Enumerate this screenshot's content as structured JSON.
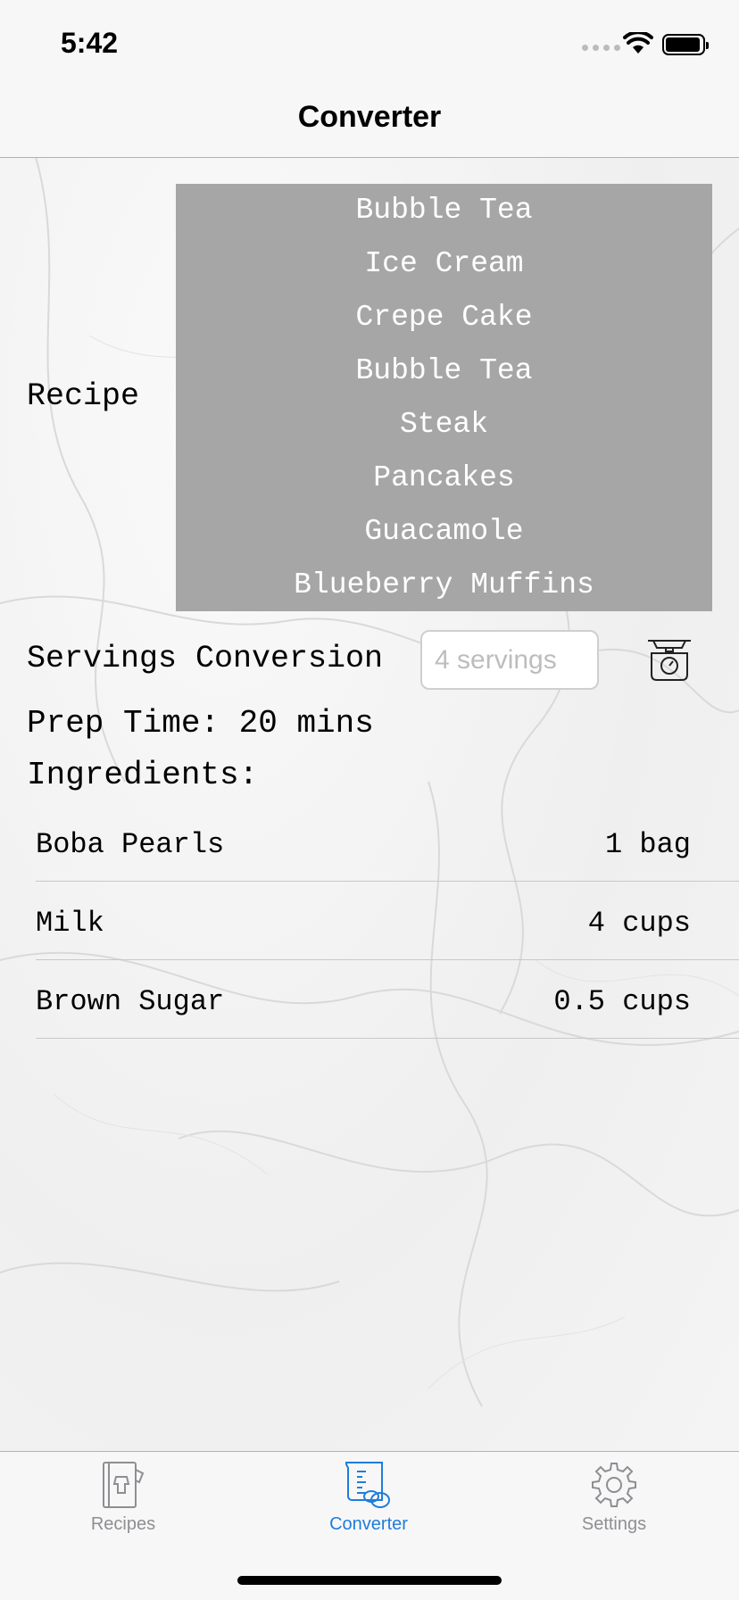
{
  "status_bar": {
    "time": "5:42"
  },
  "nav": {
    "title": "Converter"
  },
  "recipe": {
    "label": "Recipe",
    "picker_items": [
      "Bubble Tea",
      "Ice Cream",
      "Crepe Cake",
      "Bubble Tea",
      "Steak",
      "Pancakes",
      "Guacamole",
      "Blueberry Muffins"
    ]
  },
  "servings": {
    "label": "Servings Conversion",
    "placeholder": "4 servings",
    "value": ""
  },
  "prep": {
    "text": "Prep Time: 20 mins"
  },
  "ingredients": {
    "label": "Ingredients:",
    "items": [
      {
        "name": "Boba Pearls",
        "amount": "1 bag"
      },
      {
        "name": "Milk",
        "amount": "4 cups"
      },
      {
        "name": "Brown Sugar",
        "amount": "0.5 cups"
      }
    ]
  },
  "tabs": [
    {
      "label": "Recipes",
      "icon": "recipe-book-icon",
      "active": false
    },
    {
      "label": "Converter",
      "icon": "measuring-cup-icon",
      "active": true
    },
    {
      "label": "Settings",
      "icon": "gear-icon",
      "active": false
    }
  ],
  "colors": {
    "accent": "#1e7ddc",
    "picker_bg": "#a6a6a6",
    "inactive_tab": "#8e8e93"
  }
}
